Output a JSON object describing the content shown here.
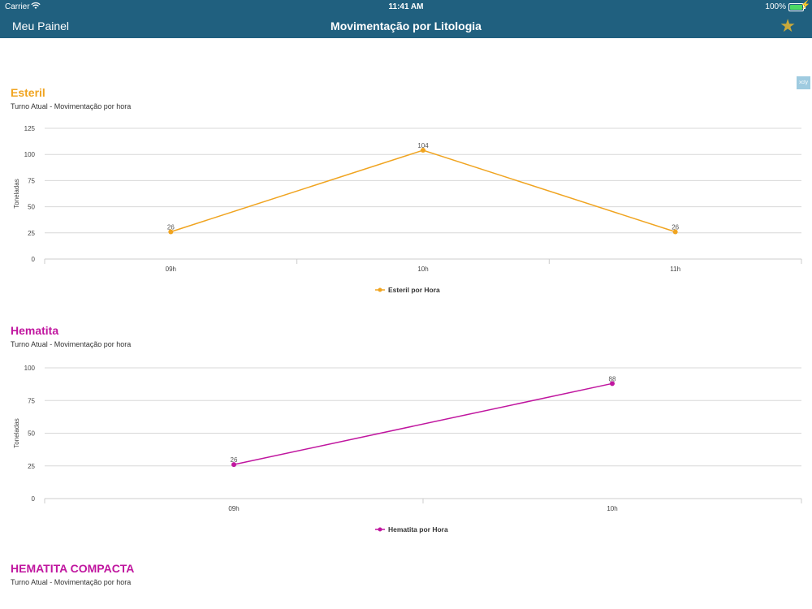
{
  "status_bar": {
    "carrier": "Carrier",
    "time": "11:41 AM",
    "battery": "100%",
    "battery_level": 1.0
  },
  "nav": {
    "back_label": "Meu Painel",
    "title": "Movimentação por Litologia"
  },
  "side_tab": "xcty",
  "colors": {
    "nav_bg": "#20607f",
    "star": "#c9a93b",
    "esteril": "#f0a420",
    "hematita": "#c0169f"
  },
  "sections": [
    {
      "title": "Esteril",
      "subtitle": "Turno Atual - Movimentação por hora"
    },
    {
      "title": "Hematita",
      "subtitle": "Turno Atual - Movimentação por hora"
    },
    {
      "title": "HEMATITA COMPACTA",
      "subtitle": "Turno Atual - Movimentação por hora"
    }
  ],
  "chart_data": [
    {
      "type": "line",
      "categories": [
        "09h",
        "10h",
        "11h"
      ],
      "series": [
        {
          "name": "Esteril por Hora",
          "values": [
            26,
            104,
            26
          ]
        }
      ],
      "ylabel": "Toneladas",
      "ylim": [
        0,
        125
      ],
      "yticks": [
        0,
        25,
        50,
        75,
        100,
        125
      ],
      "grid": true,
      "legend": "bottom-center"
    },
    {
      "type": "line",
      "categories": [
        "09h",
        "10h"
      ],
      "series": [
        {
          "name": "Hematita por Hora",
          "values": [
            26,
            88
          ]
        }
      ],
      "ylabel": "Toneladas",
      "ylim": [
        0,
        100
      ],
      "yticks": [
        0,
        25,
        50,
        75,
        100
      ],
      "grid": true,
      "legend": "bottom-center"
    }
  ]
}
